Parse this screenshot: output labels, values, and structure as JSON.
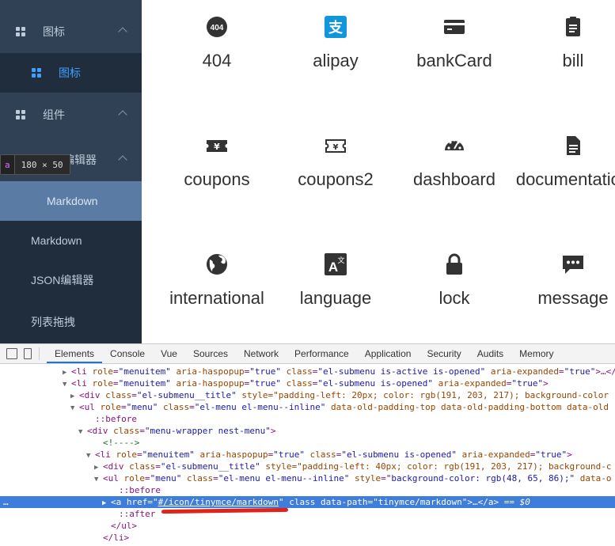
{
  "sidebar": {
    "rows": [
      {
        "label": "图标",
        "kind": "submenu"
      },
      {
        "label": "图标",
        "kind": "item-active"
      },
      {
        "label": "组件",
        "kind": "submenu"
      },
      {
        "label": "编辑器",
        "kind": "submenu"
      },
      {
        "label": "Markdown",
        "kind": "item-selected"
      },
      {
        "label": "Markdown",
        "kind": "item"
      },
      {
        "label": "JSON编辑器",
        "kind": "item"
      },
      {
        "label": "列表拖拽",
        "kind": "item"
      }
    ],
    "tooltip": {
      "tag": "a",
      "size": "180 × 50"
    }
  },
  "icons": [
    {
      "name": "404",
      "icon": "404-icon"
    },
    {
      "name": "alipay",
      "icon": "alipay-icon"
    },
    {
      "name": "bankCard",
      "icon": "bank-card-icon"
    },
    {
      "name": "bill",
      "icon": "bill-icon"
    },
    {
      "name": "coupons",
      "icon": "coupons-icon"
    },
    {
      "name": "coupons2",
      "icon": "coupons2-icon"
    },
    {
      "name": "dashboard",
      "icon": "dashboard-icon"
    },
    {
      "name": "documentation",
      "icon": "documentation-icon"
    },
    {
      "name": "international",
      "icon": "international-icon"
    },
    {
      "name": "language",
      "icon": "language-icon"
    },
    {
      "name": "lock",
      "icon": "lock-icon"
    },
    {
      "name": "message",
      "icon": "message-icon"
    }
  ],
  "devtools": {
    "tabs": [
      "Elements",
      "Console",
      "Vue",
      "Sources",
      "Network",
      "Performance",
      "Application",
      "Security",
      "Audits",
      "Memory"
    ],
    "active_tab": "Elements",
    "lines": [
      {
        "indent": 90,
        "tri": "▶",
        "html": "<li role=\"menuitem\" aria-haspopup=\"true\" class=\"el-submenu is-active is-opened\" aria-expanded=\"true\">…</li>"
      },
      {
        "indent": 90,
        "tri": "▼",
        "html": "<li role=\"menuitem\" aria-haspopup=\"true\" class=\"el-submenu is-opened\" aria-expanded=\"true\">"
      },
      {
        "indent": 100,
        "tri": "▶",
        "html": "<div class=\"el-submenu__title\" style=\"padding-left: 20px; color: rgb(191, 203, 217); background-color"
      },
      {
        "indent": 100,
        "tri": "▼",
        "html": "<ul role=\"menu\" class=\"el-menu el-menu--inline\" data-old-padding-top data-old-padding-bottom data-old"
      },
      {
        "indent": 120,
        "tri": "",
        "html": "::before"
      },
      {
        "indent": 110,
        "tri": "▼",
        "html": "<div class=\"menu-wrapper nest-menu\">"
      },
      {
        "indent": 130,
        "tri": "",
        "html": "<!---->"
      },
      {
        "indent": 120,
        "tri": "▼",
        "html": "<li role=\"menuitem\" aria-haspopup=\"true\" class=\"el-submenu is-opened\" aria-expanded=\"true\">"
      },
      {
        "indent": 130,
        "tri": "▶",
        "html": "<div class=\"el-submenu__title\" style=\"padding-left: 40px; color: rgb(191, 203, 217); background-c"
      },
      {
        "indent": 130,
        "tri": "▼",
        "html": "<ul role=\"menu\" class=\"el-menu el-menu--inline\" style=\"background-color: rgb(48, 65, 86);\" data-o"
      },
      {
        "indent": 150,
        "tri": "",
        "html": "::before"
      },
      {
        "indent": 140,
        "tri": "▶",
        "html": "<a href=\"#/icon/tinymce/markdown\" class data-path=\"tinymce/markdown\">…</a> == $0",
        "highlight": true
      },
      {
        "indent": 150,
        "tri": "",
        "html": "::after"
      },
      {
        "indent": 140,
        "tri": "",
        "html": "</ul>"
      },
      {
        "indent": 130,
        "tri": "",
        "html": "</li>"
      },
      {
        "indent": 120,
        "tri": "",
        "html": "</div>"
      }
    ],
    "gutter_marker": "…"
  },
  "colors": {
    "sidebar_bg": "#304156",
    "sidebar_submenu_bg": "#1f2d3d",
    "sidebar_selected_bg": "#5a7ba4",
    "accent": "#409eff",
    "devtools_highlight": "#3f7ddc",
    "alipay_blue": "#1296db",
    "annotation_red": "#e0231b"
  }
}
